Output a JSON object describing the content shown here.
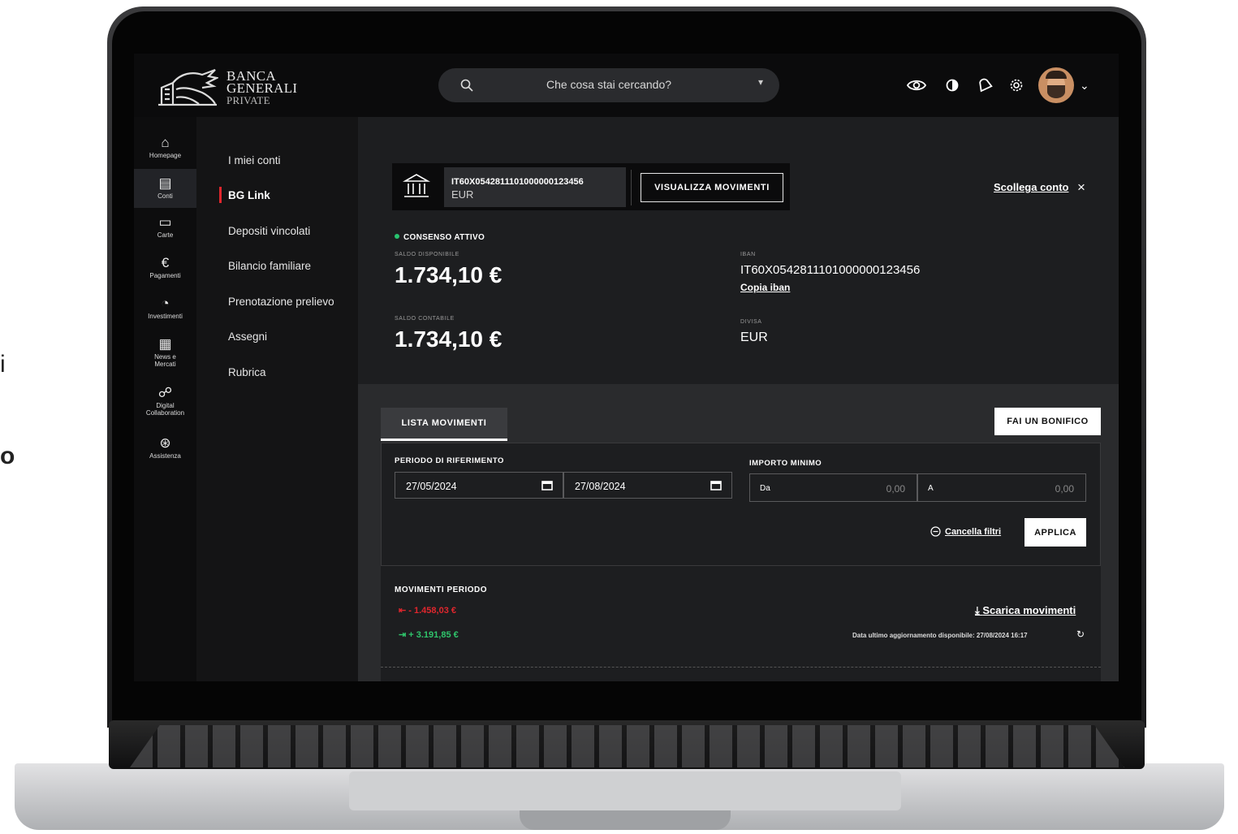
{
  "background_text": {
    "line1": "i",
    "line2": "o"
  },
  "header": {
    "logo": {
      "line1": "BANCA",
      "line2": "GENERALI",
      "line3": "PRIVATE"
    },
    "search_placeholder": "Che cosa stai cercando?",
    "icons": [
      "eye-icon",
      "contrast-icon",
      "bell-icon",
      "gear-icon"
    ],
    "avatar_caret": "⌄"
  },
  "rail": {
    "items": [
      {
        "label": "Homepage",
        "icon": "home-icon",
        "glyph": "⌂"
      },
      {
        "label": "Conti",
        "icon": "database-icon",
        "glyph": "▤"
      },
      {
        "label": "Carte",
        "icon": "card-icon",
        "glyph": "▭"
      },
      {
        "label": "Pagamenti",
        "icon": "euro-icon",
        "glyph": "€"
      },
      {
        "label": "Investimenti",
        "icon": "pie-icon",
        "glyph": "◔"
      },
      {
        "label_line1": "News e",
        "label_line2": "Mercati",
        "icon": "news-icon",
        "glyph": "▦"
      },
      {
        "label_line1": "Digital",
        "label_line2": "Collaboration",
        "icon": "handshake-icon",
        "glyph": "☍"
      },
      {
        "label": "Assistenza",
        "icon": "lifebuoy-icon",
        "glyph": "⊛"
      }
    ],
    "active_index": 1
  },
  "subnav": {
    "items": [
      "I miei conti",
      "BG Link",
      "Depositi vincolati",
      "Bilancio familiare",
      "Prenotazione prelievo",
      "Assegni",
      "Rubrica"
    ],
    "active": "BG Link"
  },
  "account": {
    "iban_short": "IT60X0542811101000000123456",
    "currency": "EUR",
    "movements_button": "VISUALIZZA MOVIMENTI",
    "unlink": "Scollega conto",
    "unlink_icon": "×"
  },
  "status": {
    "consent": "CONSENSO ATTIVO",
    "consent_color": "#28c36f",
    "available_label": "SALDO DISPONIBILE",
    "available_value": "1.734,10 €",
    "accounting_label": "SALDO CONTABILE",
    "accounting_value": "1.734,10 €",
    "iban_label": "IBAN",
    "iban_value": "IT60X0542811101000000123456",
    "copy_iban": "Copia iban",
    "currency_label": "DIVISA",
    "currency_value": "EUR"
  },
  "movements": {
    "tab": "LISTA MOVIMENTI",
    "transfer_button": "FAI UN BONIFICO",
    "period_label": "PERIODO DI RIFERIMENTO",
    "date_from": "27/05/2024",
    "date_to": "27/08/2024",
    "amount_label": "IMPORTO MINIMO",
    "amount_from_label": "Da",
    "amount_from_placeholder": "0,00",
    "amount_to_label": "A",
    "amount_to_placeholder": "0,00",
    "clear_filters": "Cancella filtri",
    "apply": "APPLICA",
    "period_title": "MOVIMENTI PERIODO",
    "outflow": "- 1.458,03 €",
    "inflow": "+ 3.191,85 €",
    "outflow_color": "#e0262d",
    "inflow_color": "#2fc56b",
    "download": "Scarica movimenti",
    "last_update": "Data ultimo aggiornamento disponibile: 27/08/2024 16:17"
  }
}
